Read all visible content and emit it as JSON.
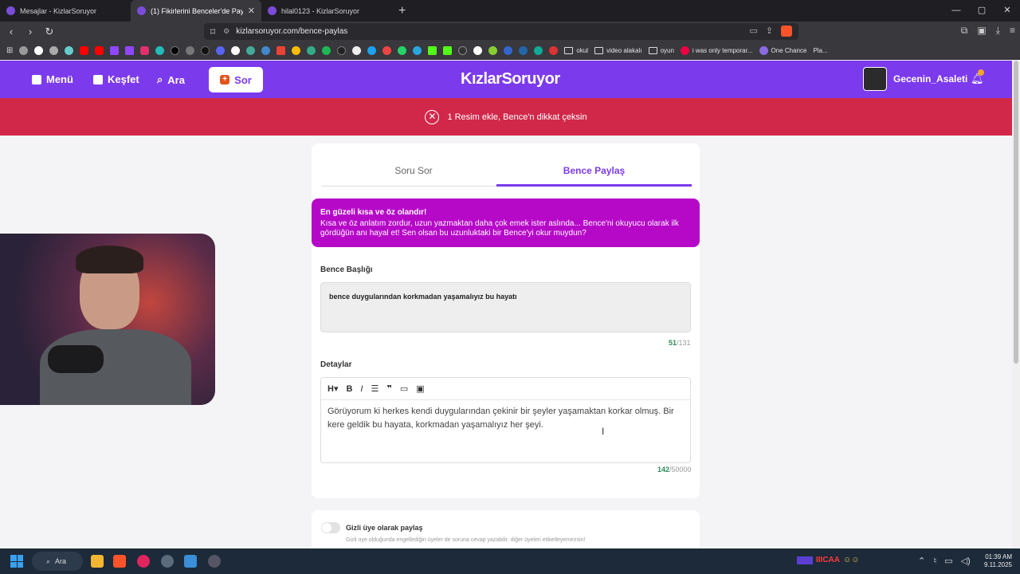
{
  "browser": {
    "tabs": [
      {
        "title": "Mesajlar - KizlarSoruyor",
        "active": false
      },
      {
        "title": "(1) Fikirlerini Benceler'de Paylaş",
        "active": true
      },
      {
        "title": "hilal0123 - KizlarSoruyor",
        "active": false
      }
    ],
    "url": "kizlarsoruyor.com/bence-paylas",
    "bookmarks": [
      "okul",
      "video alakalı",
      "oyun",
      "i was only temporar...",
      "One Chance",
      "Pla..."
    ]
  },
  "header": {
    "menu_label": "Menü",
    "explore_label": "Keşfet",
    "search_label": "Ara",
    "ask_label": "Sor",
    "logo": "KızlarSoruyor",
    "username": "Gecenin_Asaleti",
    "notification_count": "1"
  },
  "alert": {
    "text": "1 Resim ekle, Bence'n dikkat çeksin"
  },
  "form": {
    "tabs": [
      "Soru Sor",
      "Bence Paylaş"
    ],
    "active_tab": "Bence Paylaş",
    "tip_title": "En güzeli kısa ve öz olandır!",
    "tip_text": "Kısa ve öz anlatım zordur, uzun yazmaktan daha çok emek ister aslında... Bence'ni okuyucu olarak ilk gördüğün anı hayal et! Sen olsan bu uzunluktaki bir Bence'yi okur muydun?",
    "title_label": "Bence Başlığı",
    "title_value": "bence duygularından korkmadan yaşamalıyız bu hayatı",
    "title_count": "51",
    "title_max": "/131",
    "details_label": "Detaylar",
    "details_value": "Görüyorum ki herkes kendi duygularından çekinir bir şeyler yaşamaktan korkar olmuş. Bir kere geldik bu hayata, korkmadan yaşamalıyız her şeyi.",
    "details_count": "142",
    "details_max": "/50000",
    "anonymous_label": "Gizli üye olarak paylaş",
    "anonymous_note": "Gizli üye olduğunda engellediğin üyeler de soruna cevap yazabilir, diğer üyeleri etiketleyemezsin!"
  },
  "taskbar": {
    "search_label": "Ara",
    "streamer": "IIICAA",
    "time": "01:39 AM",
    "date": "9.11.2025"
  },
  "colors": {
    "brand": "#7c3aed",
    "alert": "#d1284a",
    "tip": "#b609c8"
  }
}
